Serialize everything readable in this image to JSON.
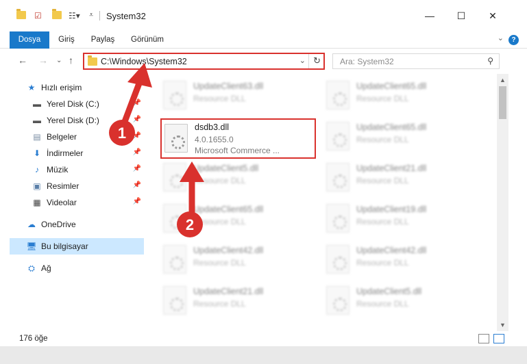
{
  "window": {
    "title": "System32",
    "minimize": "—",
    "maximize": "☐",
    "close": "✕"
  },
  "ribbon": {
    "tabs": [
      "Dosya",
      "Giriş",
      "Paylaş",
      "Görünüm"
    ],
    "help": "?"
  },
  "address": {
    "path": "C:\\Windows\\System32",
    "search_placeholder": "Ara: System32"
  },
  "sidebar": {
    "quick_access": "Hızlı erişim",
    "items": [
      {
        "label": "Yerel Disk (C:)",
        "icon": "drive-icon",
        "pinned": true
      },
      {
        "label": "Yerel Disk (D:)",
        "icon": "drive-icon",
        "pinned": true
      },
      {
        "label": "Belgeler",
        "icon": "documents-icon",
        "pinned": true
      },
      {
        "label": "İndirmeler",
        "icon": "download-icon",
        "pinned": true
      },
      {
        "label": "Müzik",
        "icon": "music-icon",
        "pinned": true
      },
      {
        "label": "Resimler",
        "icon": "pictures-icon",
        "pinned": true
      },
      {
        "label": "Videolar",
        "icon": "videos-icon",
        "pinned": true
      }
    ],
    "onedrive": "OneDrive",
    "this_pc": "Bu bilgisayar",
    "network": "Ağ"
  },
  "files": {
    "highlighted": {
      "name": "dsdb3.dll",
      "version": "4.0.1655.0",
      "description": "Microsoft Commerce ..."
    },
    "left_column": [
      {
        "name": "UpdateClient63.dll",
        "desc": "Resource DLL"
      },
      {
        "name": "UpdateClient5.dll",
        "desc": "Resource DLL"
      },
      {
        "name": "UpdateClient65.dll",
        "desc": "Resource DLL"
      },
      {
        "name": "UpdateClient42.dll",
        "desc": "Resource DLL"
      },
      {
        "name": "UpdateClient21.dll",
        "desc": "Resource DLL"
      }
    ],
    "right_column": [
      {
        "name": "UpdateClient65.dll",
        "desc": "Resource DLL"
      },
      {
        "name": "UpdateClient65.dll",
        "desc": "Resource DLL"
      },
      {
        "name": "UpdateClient21.dll",
        "desc": "Resource DLL"
      },
      {
        "name": "UpdateClient19.dll",
        "desc": "Resource DLL"
      },
      {
        "name": "UpdateClient42.dll",
        "desc": "Resource DLL"
      },
      {
        "name": "UpdateClient5.dll",
        "desc": "Resource DLL"
      }
    ]
  },
  "status": {
    "count": "176 öğe"
  },
  "annotations": {
    "step1": "1",
    "step2": "2",
    "color": "#d9312d"
  }
}
